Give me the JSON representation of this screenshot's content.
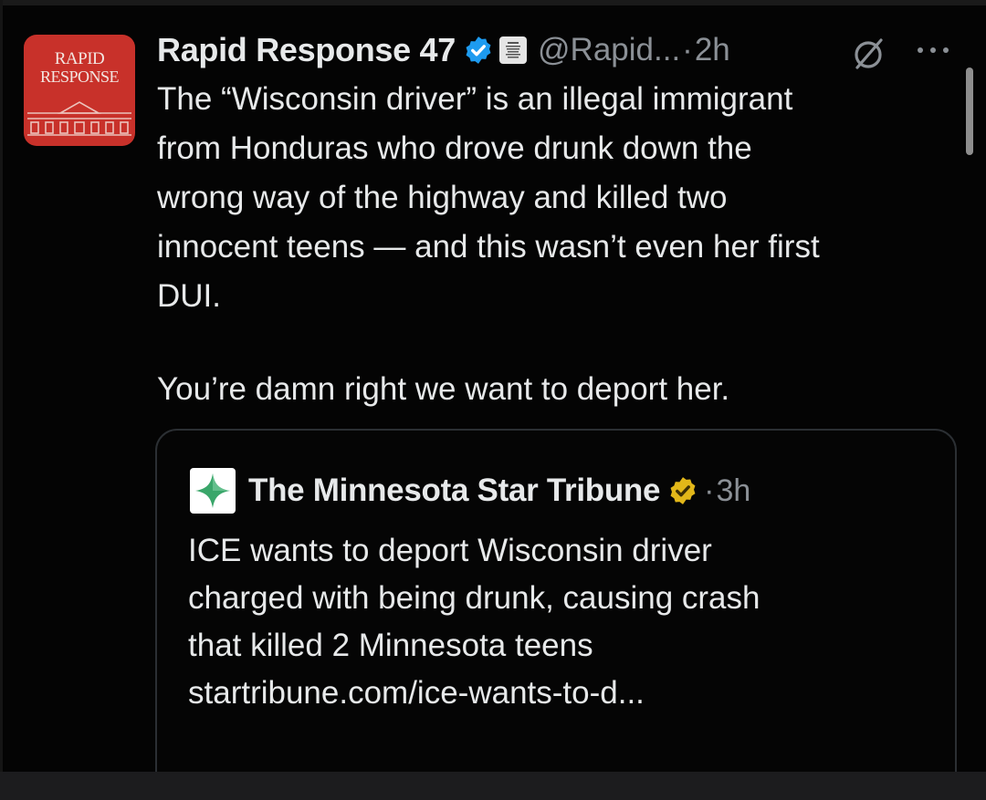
{
  "post": {
    "avatar_text_line1": "RAPID",
    "avatar_text_line2": "RESPONSE",
    "display_name": "Rapid Response 47",
    "handle": "@Rapid...",
    "separator": "·",
    "time": "2h",
    "verified_icon": "verified-badge-icon",
    "affiliation_icon": "white-house-badge-icon",
    "text_lines": [
      "The “Wisconsin driver” is an illegal immigrant",
      "from Honduras who drove drunk down the",
      "wrong way of the highway and killed two",
      "innocent teens — and this wasn’t even her first",
      "DUI."
    ],
    "text_line_final": "You’re damn right we want to deport her."
  },
  "quote": {
    "display_name": "The Minnesota Star Tribune",
    "separator": "·",
    "time": "3h",
    "verified_icon": "gold-verified-badge-icon",
    "text_lines": [
      "ICE wants to deport Wisconsin driver",
      "charged with being drunk, causing crash",
      "that killed 2 Minnesota teens",
      "startribune.com/ice-wants-to-d..."
    ]
  },
  "colors": {
    "background": "#000000",
    "text_primary": "#e7e9ea",
    "text_secondary": "#8b9096",
    "avatar_red": "#c8312a",
    "verified_blue": "#1d9bf0",
    "verified_gold": "#e2b719",
    "star_green": "#3aa66a"
  }
}
